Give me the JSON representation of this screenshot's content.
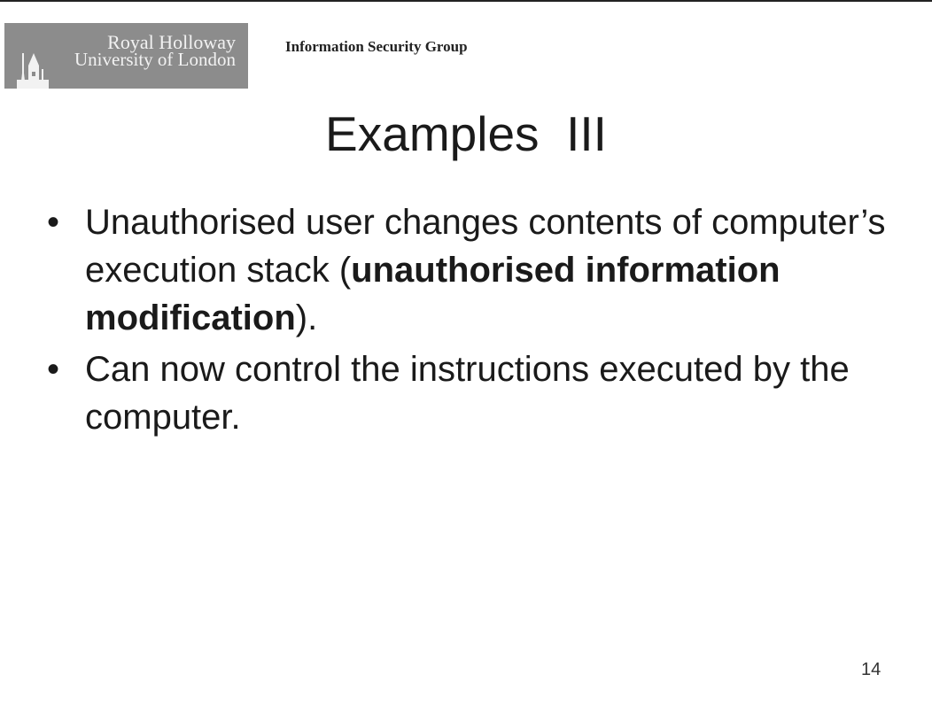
{
  "header": {
    "logo": {
      "line1": "Royal Holloway",
      "line2": "University of London"
    },
    "group_name": "Information Security Group"
  },
  "slide": {
    "title": "Examples  III",
    "bullets": [
      {
        "pre": "Unauthorised user changes contents of computer’s execution stack (",
        "bold": "unauthorised information modification",
        "post": ")."
      },
      {
        "pre": "Can now control the instructions executed by the computer.",
        "bold": "",
        "post": ""
      }
    ],
    "bullet_symbol": "•",
    "page_number": "14"
  }
}
